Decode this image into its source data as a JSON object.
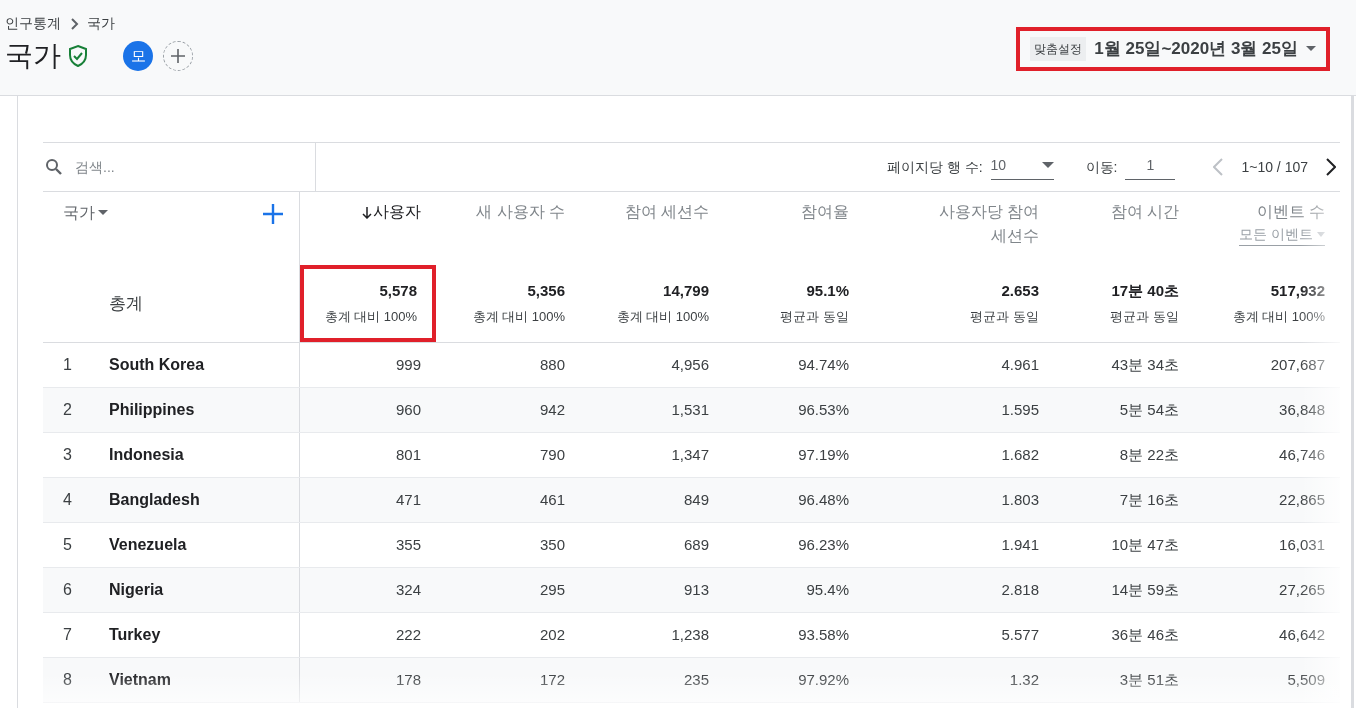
{
  "breadcrumb": [
    "인구통계",
    "국가"
  ],
  "title": "국가",
  "avatar": "모",
  "date_range": {
    "label": "맞춤설정",
    "value": "1월 25일~2020년 3월 25일",
    "highlighted": true
  },
  "search": {
    "placeholder": "검색..."
  },
  "pagination": {
    "rows_label": "페이지당 행 수:",
    "rows_value": "10",
    "goto_label": "이동:",
    "goto_value": "1",
    "range": "1~10 / 107"
  },
  "dimension": {
    "label": "국가"
  },
  "columns": [
    {
      "label": "사용자",
      "sorted": true
    },
    {
      "label": "새 사용자 수",
      "sorted": false
    },
    {
      "label": "참여 세션수",
      "sorted": false
    },
    {
      "label": "참여율",
      "sorted": false
    },
    {
      "label": "사용자당 참여 세션수",
      "sorted": false
    },
    {
      "label": "참여 시간",
      "sorted": false
    },
    {
      "label": "이벤트 수",
      "sorted": false,
      "filter": "모든 이벤트"
    }
  ],
  "totals": {
    "label": "총계",
    "cells": [
      {
        "value": "5,578",
        "note": "총계 대비 100%",
        "highlighted": true
      },
      {
        "value": "5,356",
        "note": "총계 대비 100%",
        "highlighted": false
      },
      {
        "value": "14,799",
        "note": "총계 대비 100%",
        "highlighted": false
      },
      {
        "value": "95.1%",
        "note": "평균과 동일",
        "highlighted": false
      },
      {
        "value": "2.653",
        "note": "평균과 동일",
        "highlighted": false
      },
      {
        "value": "17분 40초",
        "note": "평균과 동일",
        "highlighted": false
      },
      {
        "value": "517,932",
        "note": "총계 대비 100%",
        "highlighted": false
      }
    ]
  },
  "rows": [
    {
      "rank": "1",
      "country": "South Korea",
      "values": [
        "999",
        "880",
        "4,956",
        "94.74%",
        "4.961",
        "43분 34초",
        "207,687"
      ]
    },
    {
      "rank": "2",
      "country": "Philippines",
      "values": [
        "960",
        "942",
        "1,531",
        "96.53%",
        "1.595",
        "5분 54초",
        "36,848"
      ]
    },
    {
      "rank": "3",
      "country": "Indonesia",
      "values": [
        "801",
        "790",
        "1,347",
        "97.19%",
        "1.682",
        "8분 22초",
        "46,746"
      ]
    },
    {
      "rank": "4",
      "country": "Bangladesh",
      "values": [
        "471",
        "461",
        "849",
        "96.48%",
        "1.803",
        "7분 16초",
        "22,865"
      ]
    },
    {
      "rank": "5",
      "country": "Venezuela",
      "values": [
        "355",
        "350",
        "689",
        "96.23%",
        "1.941",
        "10분 47초",
        "16,031"
      ]
    },
    {
      "rank": "6",
      "country": "Nigeria",
      "values": [
        "324",
        "295",
        "913",
        "95.4%",
        "2.818",
        "14분 59초",
        "27,265"
      ]
    },
    {
      "rank": "7",
      "country": "Turkey",
      "values": [
        "222",
        "202",
        "1,238",
        "93.58%",
        "5.577",
        "36분 46초",
        "46,642"
      ]
    },
    {
      "rank": "8",
      "country": "Vietnam",
      "values": [
        "178",
        "172",
        "235",
        "97.92%",
        "1.32",
        "3분 51초",
        "5,509"
      ]
    }
  ]
}
